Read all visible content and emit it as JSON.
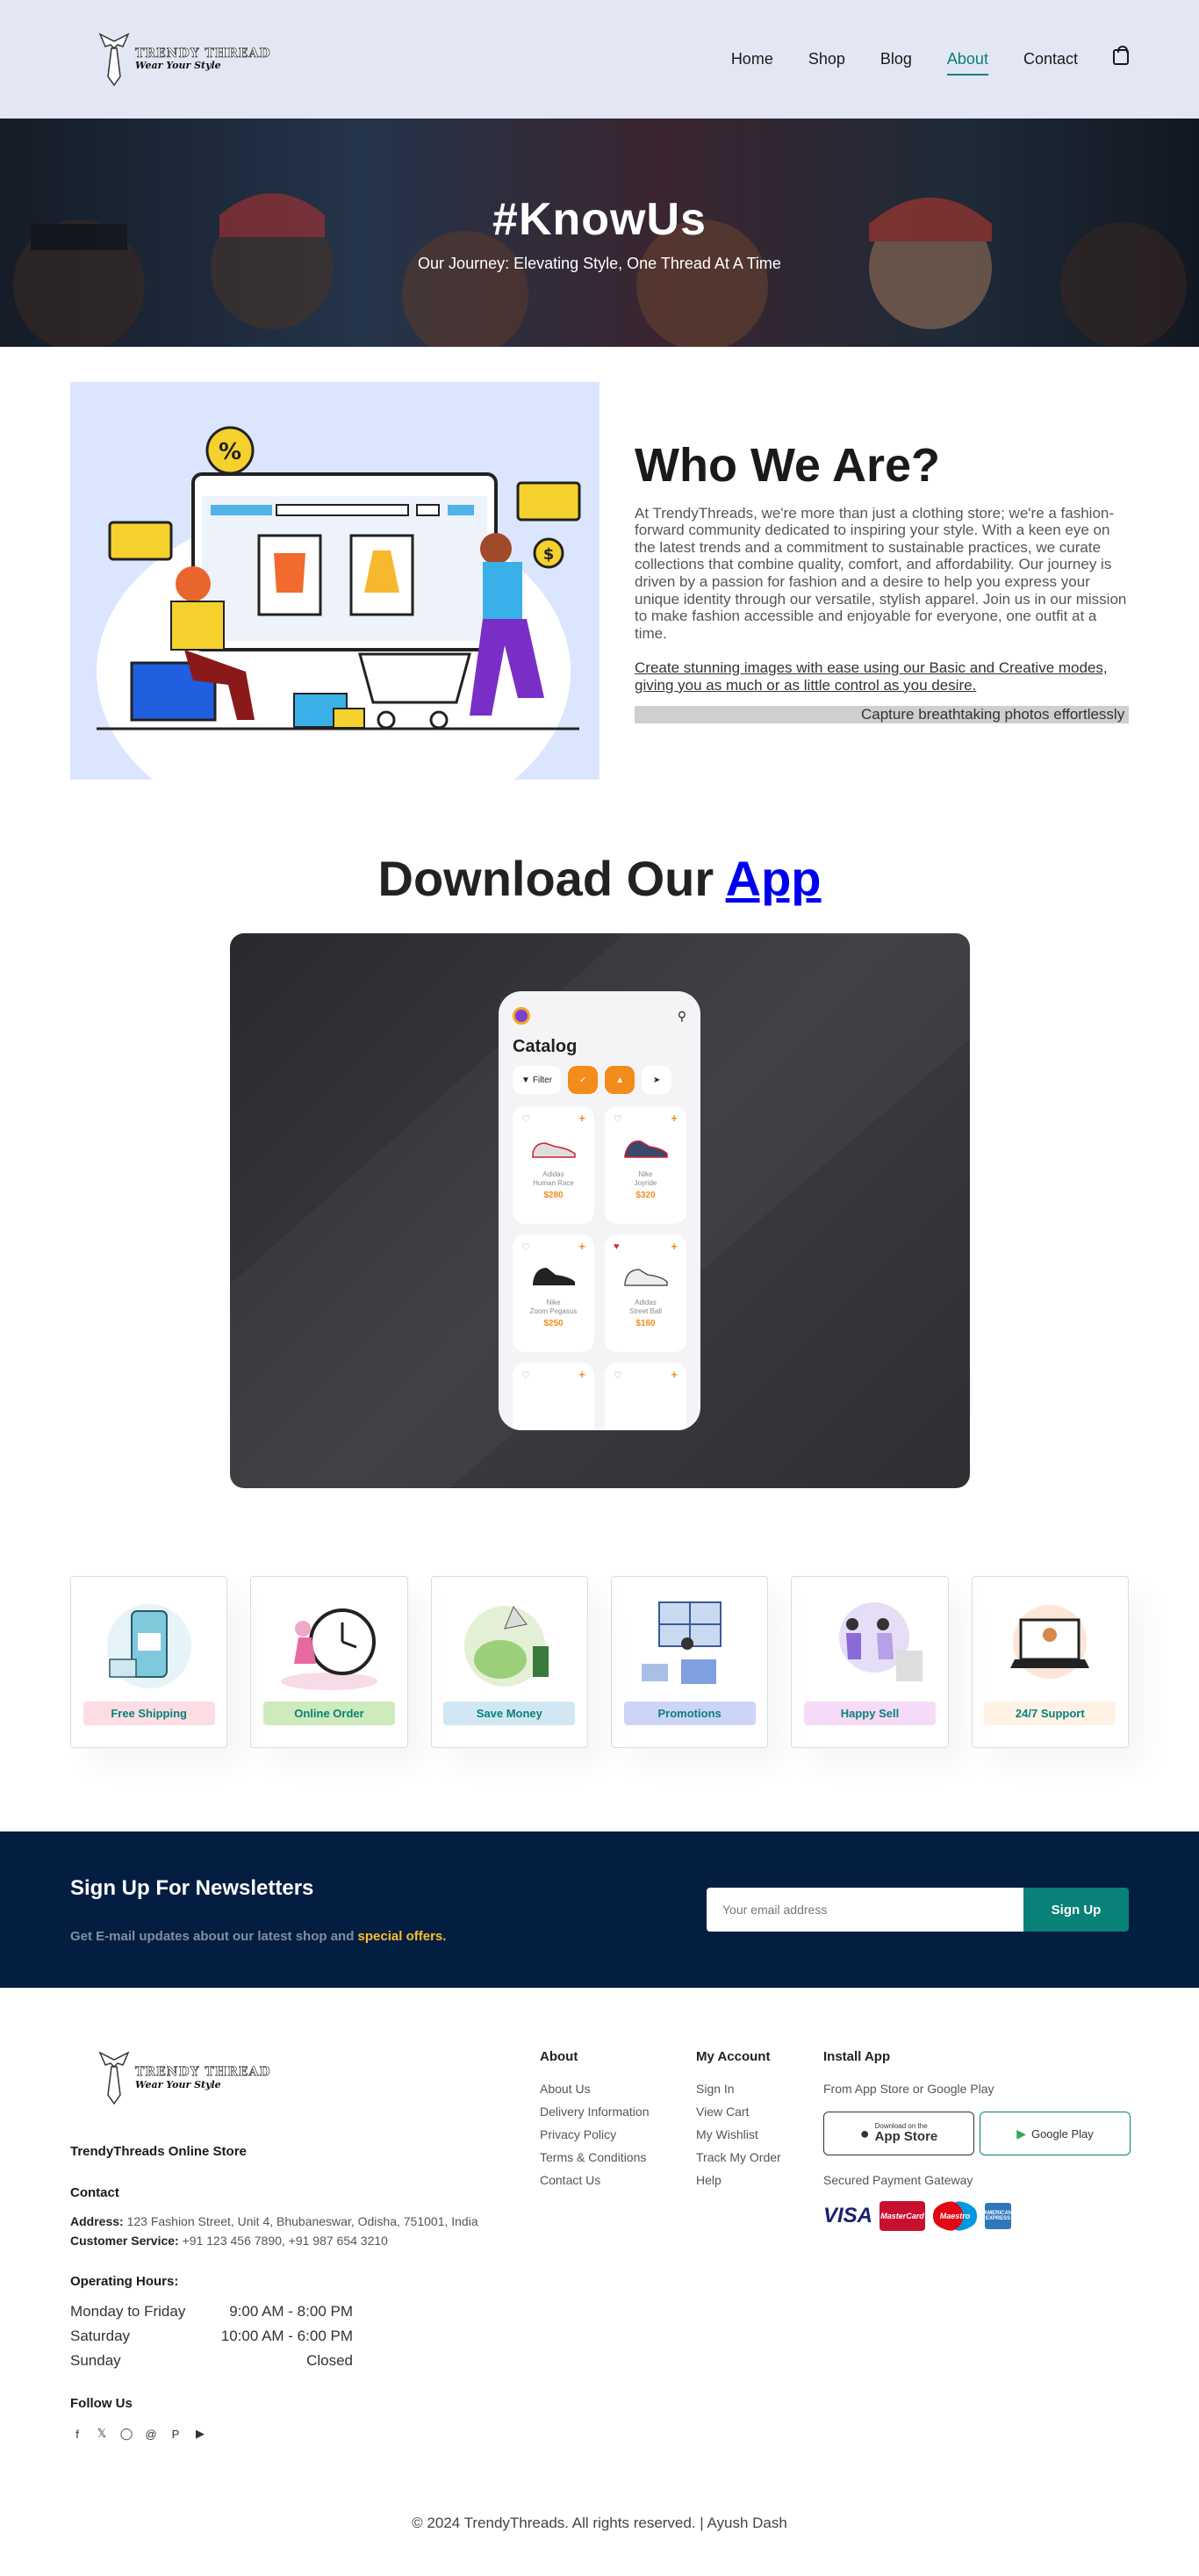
{
  "brand": {
    "logo_line1": "TRENDY THREAD",
    "logo_line2": "Wear Your Style"
  },
  "nav": {
    "items": [
      {
        "label": "Home",
        "active": false
      },
      {
        "label": "Shop",
        "active": false
      },
      {
        "label": "Blog",
        "active": false
      },
      {
        "label": "About",
        "active": true
      },
      {
        "label": "Contact",
        "active": false
      }
    ],
    "cart_icon": "shopping-bag-icon"
  },
  "hero": {
    "title": "#KnowUs",
    "subtitle": "Our Journey: Elevating Style, One Thread At A Time"
  },
  "about": {
    "heading": "Who We Are?",
    "paragraph": "At TrendyThreads, we're more than just a clothing store; we're a fashion-forward community dedicated to inspiring your style. With a keen eye on the latest trends and a commitment to sustainable practices, we curate collections that combine quality, comfort, and affordability. Our journey is driven by a passion for fashion and a desire to help you express your unique identity through our versatile, stylish apparel. Join us in our mission to make fashion accessible and enjoyable for everyone, one outfit at a time.",
    "abbr_text": "Create stunning images with ease using our Basic and Creative modes, giving you as much or as little control as you desire.",
    "marquee_text": "Capture breathtaking photos effortlessly"
  },
  "app": {
    "heading_prefix": "Download Our",
    "heading_link": "App",
    "phone": {
      "title": "Catalog",
      "filter_label": "Filter",
      "products": [
        {
          "name": "Adidas\nHuman Race",
          "price": "$280",
          "liked": false
        },
        {
          "name": "Nike\nJoyride",
          "price": "$320",
          "liked": false
        },
        {
          "name": "Nike\nZoom Pegasus",
          "price": "$250",
          "liked": false
        },
        {
          "name": "Adidas\nStreet Ball",
          "price": "$160",
          "liked": true
        }
      ]
    }
  },
  "features": [
    {
      "label": "Free Shipping",
      "bg": "#fddde4",
      "icon": "delivery-illustration"
    },
    {
      "label": "Online Order",
      "bg": "#cdebbc",
      "icon": "clock-illustration"
    },
    {
      "label": "Save Money",
      "bg": "#d1e8f2",
      "icon": "piggy-bank-illustration"
    },
    {
      "label": "Promotions",
      "bg": "#cdd4f8",
      "icon": "email-illustration"
    },
    {
      "label": "Happy Sell",
      "bg": "#f6dbf6",
      "icon": "high-five-illustration"
    },
    {
      "label": "24/7 Support",
      "bg": "#fff2e5",
      "icon": "laptop-support-illustration"
    }
  ],
  "newsletter": {
    "heading": "Sign Up For Newsletters",
    "text": "Get E-mail updates about our latest shop and",
    "highlight": "special offers.",
    "placeholder": "Your email address",
    "button": "Sign Up"
  },
  "footer": {
    "store_name": "TrendyThreads Online Store",
    "contact_heading": "Contact",
    "address_label": "Address:",
    "address": "123 Fashion Street, Unit 4, Bhubaneswar, Odisha, 751001, India",
    "service_label": "Customer Service:",
    "service": "+91 123 456 7890, +91 987 654 3210",
    "hours_heading": "Operating Hours:",
    "hours": [
      {
        "day": "Monday to Friday",
        "time": "9:00 AM - 8:00 PM"
      },
      {
        "day": "Saturday",
        "time": "10:00 AM - 6:00 PM"
      },
      {
        "day": "Sunday",
        "time": "Closed"
      }
    ],
    "follow_heading": "Follow Us",
    "socials": [
      "facebook-icon",
      "x-icon",
      "instagram-icon",
      "threads-icon",
      "pinterest-icon",
      "youtube-icon"
    ],
    "about_heading": "About",
    "about_links": [
      "About Us",
      "Delivery Information",
      "Privacy Policy",
      "Terms & Conditions",
      "Contact Us"
    ],
    "account_heading": "My Account",
    "account_links": [
      "Sign In",
      "View Cart",
      "My Wishlist",
      "Track My Order",
      "Help"
    ],
    "install_heading": "Install App",
    "install_sub": "From App Store or Google Play",
    "appstore_small": "Download on the",
    "appstore_big": "App Store",
    "googleplay": "Google Play",
    "payment_heading": "Secured Payment Gateway",
    "payments": [
      "VISA",
      "MasterCard",
      "Maestro",
      "AMERICAN EXPRESS"
    ],
    "copyright": "© 2024 TrendyThreads. All rights reserved. | Ayush Dash"
  }
}
